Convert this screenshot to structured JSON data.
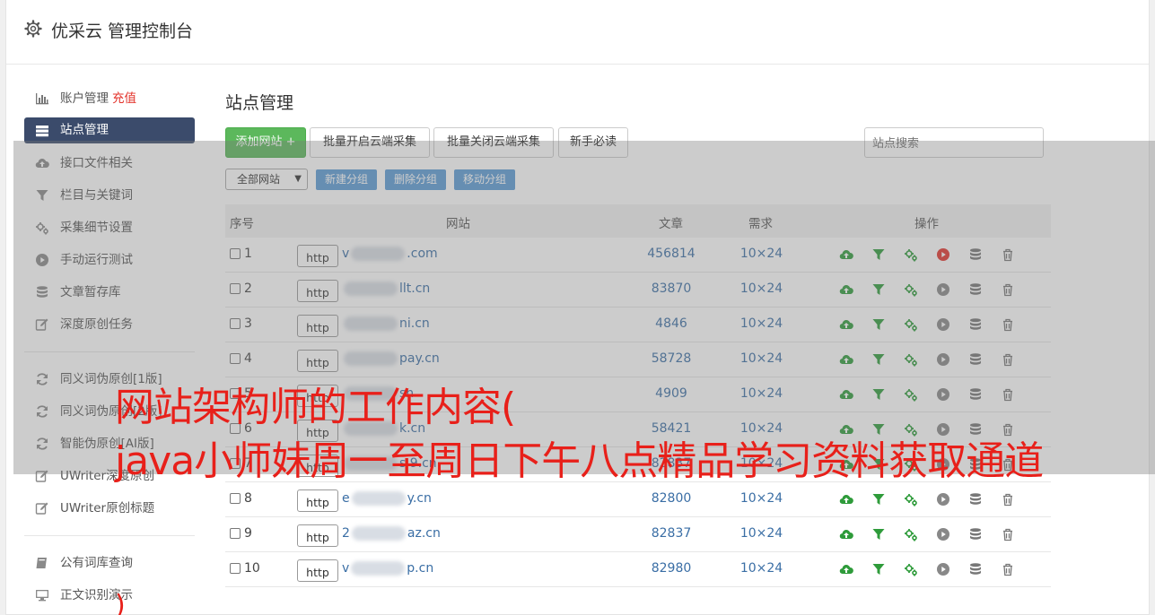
{
  "header": {
    "title": "优采云 管理控制台"
  },
  "sidebar": {
    "account": "账户管理",
    "recharge": "充值",
    "items": [
      {
        "label": "站点管理",
        "icon": "server-icon",
        "active": true
      },
      {
        "label": "接口文件相关",
        "icon": "cloud-upload-icon"
      },
      {
        "label": "栏目与关键词",
        "icon": "filter-icon"
      },
      {
        "label": "采集细节设置",
        "icon": "gears-icon"
      },
      {
        "label": "手动运行测试",
        "icon": "play-circle-icon"
      },
      {
        "label": "文章暂存库",
        "icon": "database-icon"
      },
      {
        "label": "深度原创任务",
        "icon": "edit-icon"
      }
    ],
    "group2": [
      {
        "label": "同义词伪原创[1版]",
        "icon": "refresh-icon"
      },
      {
        "label": "同义词伪原创[2版]",
        "icon": "refresh-icon"
      },
      {
        "label": "智能伪原创[AI版]",
        "icon": "refresh-icon"
      },
      {
        "label": "UWriter深度原创",
        "icon": "edit-icon"
      },
      {
        "label": "UWriter原创标题",
        "icon": "edit-icon"
      }
    ],
    "group3": [
      {
        "label": "公有词库查询",
        "icon": "book-icon"
      },
      {
        "label": "正文识别演示",
        "icon": "monitor-icon"
      }
    ]
  },
  "main": {
    "title": "站点管理",
    "add_site": "添加网站 +",
    "batch_on": "批量开启云端采集",
    "batch_off": "批量关闭云端采集",
    "newbie": "新手必读",
    "search_placeholder": "站点搜索",
    "group_select": "全部网站",
    "new_group": "新建分组",
    "delete_group": "删除分组",
    "move_group": "移动分组"
  },
  "table": {
    "headers": {
      "seq": "序号",
      "site": "网站",
      "articles": "文章",
      "need": "需求",
      "ops": "操作"
    },
    "http_label": "http",
    "rows": [
      {
        "num": "1",
        "pre": "v",
        "post": ".com",
        "articles": "456814",
        "need": "10×24",
        "running": true
      },
      {
        "num": "2",
        "pre": "",
        "post": "llt.cn",
        "articles": "83870",
        "need": "10×24"
      },
      {
        "num": "3",
        "pre": "",
        "post": "ni.cn",
        "articles": "4846",
        "need": "10×24"
      },
      {
        "num": "4",
        "pre": "",
        "post": "pay.cn",
        "articles": "58728",
        "need": "10×24"
      },
      {
        "num": "5",
        "pre": "",
        "post": "sn",
        "articles": "4909",
        "need": "10×24"
      },
      {
        "num": "6",
        "pre": "",
        "post": "k.cn",
        "articles": "58421",
        "need": "10×24"
      },
      {
        "num": "7",
        "pre": "",
        "post": "s 9.cn",
        "articles": "82837",
        "need": "10×24"
      },
      {
        "num": "8",
        "pre": "e",
        "post": "y.cn",
        "articles": "82800",
        "need": "10×24"
      },
      {
        "num": "9",
        "pre": "2",
        "post": "az.cn",
        "articles": "82837",
        "need": "10×24"
      },
      {
        "num": "10",
        "pre": "v",
        "post": "p.cn",
        "articles": "82980",
        "need": "10×24"
      }
    ]
  },
  "ad": {
    "line1": "网站架构师的工作内容(",
    "line2": "java小师妹周一至周日下午八点精品学习资料获取通道",
    "line3": ")"
  },
  "colors": {
    "green": "#2e9b3a",
    "red": "#e3322a",
    "sidebar_active": "#3b4b6b",
    "link": "#3a6ea5"
  }
}
